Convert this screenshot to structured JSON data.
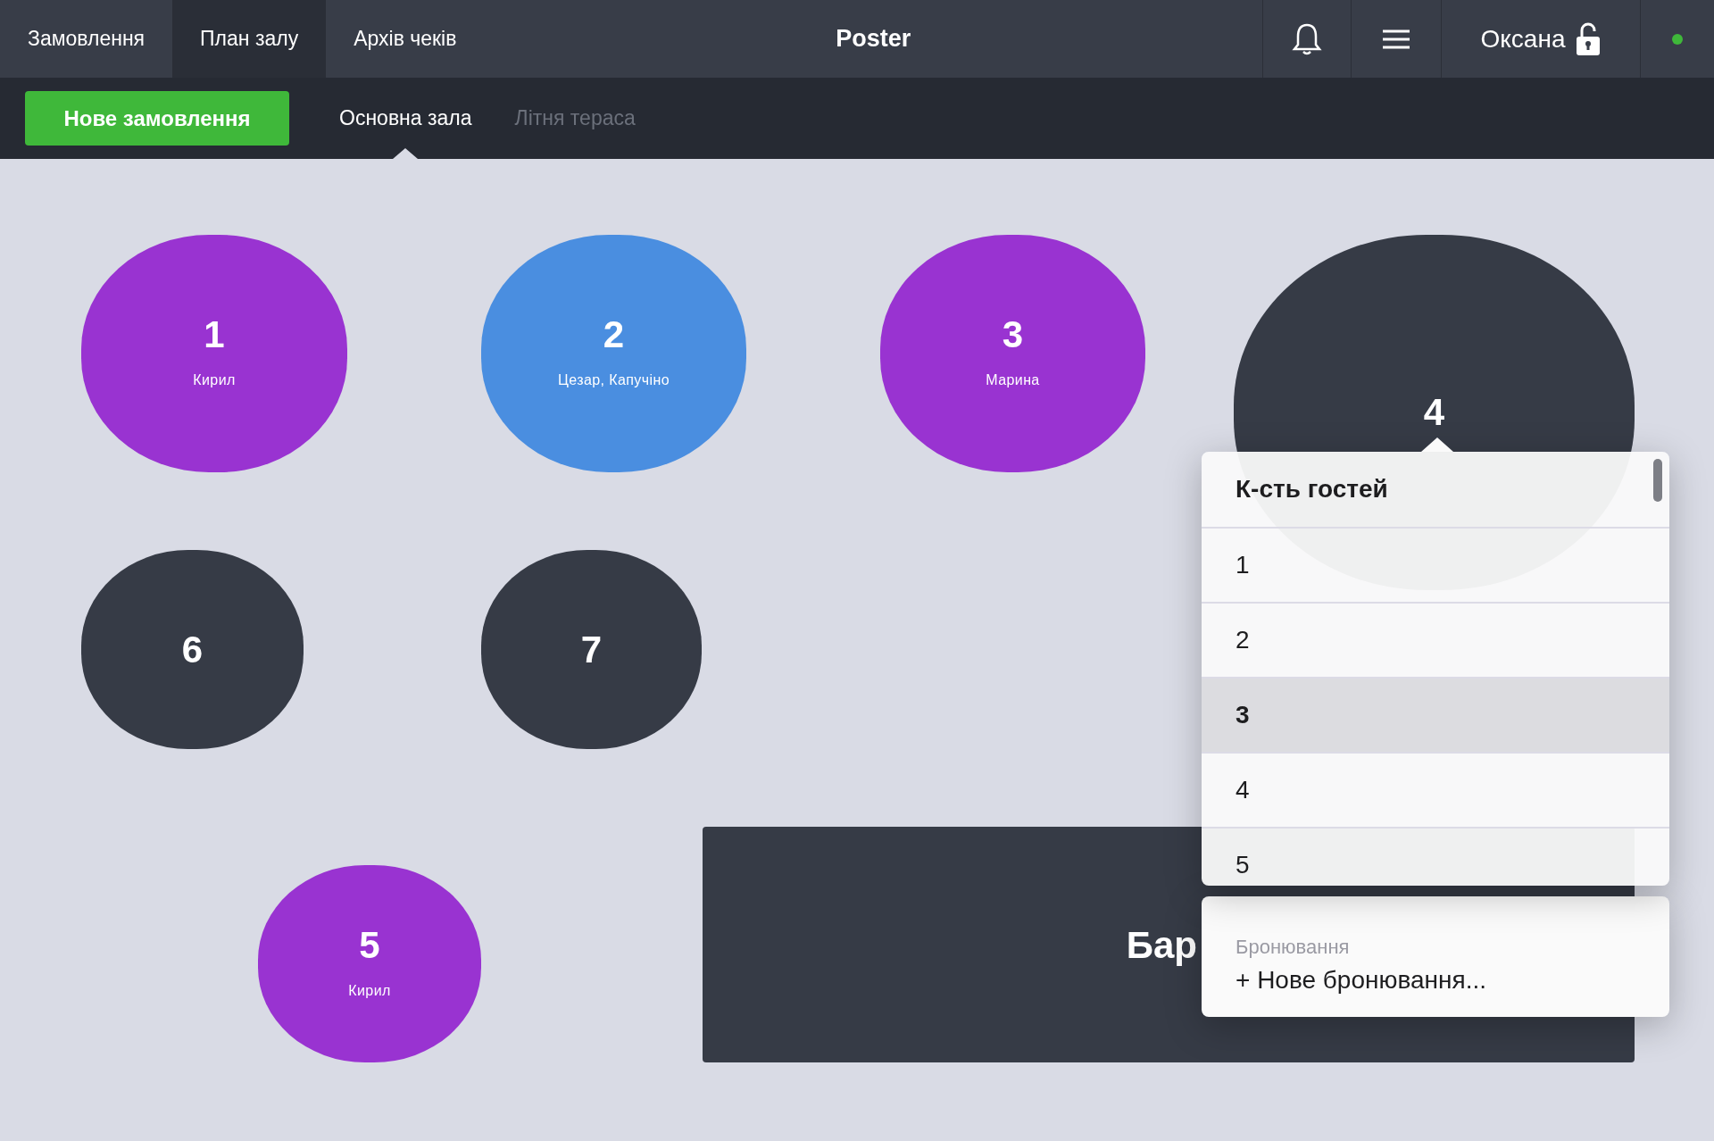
{
  "nav_tabs": [
    {
      "label": "Замовлення",
      "selected": false
    },
    {
      "label": "План залу",
      "selected": true
    },
    {
      "label": "Архів чеків",
      "selected": false
    }
  ],
  "app_title": "Poster",
  "user": {
    "name": "Оксана",
    "locked": false,
    "online": true
  },
  "new_order_button": "Нове замовлення",
  "hall_tabs": [
    {
      "label": "Основна зала",
      "selected": true
    },
    {
      "label": "Літня тераса",
      "selected": false
    }
  ],
  "tables": [
    {
      "kind": "round",
      "number": "1",
      "guests": "Кирил",
      "color": "#9933d1"
    },
    {
      "kind": "round",
      "number": "2",
      "guests": "Цезар, Капучіно",
      "color": "#4a8ee0"
    },
    {
      "kind": "round",
      "number": "3",
      "guests": "Марина",
      "color": "#9933d1"
    },
    {
      "kind": "round",
      "number": "4",
      "color": "#363b46"
    },
    {
      "kind": "round",
      "number": "6",
      "color": "#363b46"
    },
    {
      "kind": "round",
      "number": "7",
      "color": "#363b46"
    },
    {
      "kind": "round",
      "number": "5",
      "guests": "Кирил",
      "color": "#9933d1"
    },
    {
      "kind": "bar",
      "number": "Бар",
      "color": "#363b46"
    }
  ],
  "guest_popup": {
    "title": "К-сть гостей",
    "options": [
      {
        "label": "1",
        "selected": false
      },
      {
        "label": "2",
        "selected": false
      },
      {
        "label": "3",
        "selected": true
      },
      {
        "label": "4",
        "selected": false
      },
      {
        "label": "5",
        "selected": false
      }
    ],
    "booking_label": "Бронювання",
    "booking_action": "+ Нове бронювання..."
  }
}
